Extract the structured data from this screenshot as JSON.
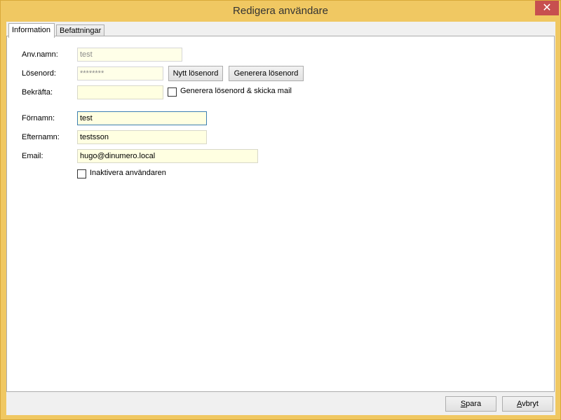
{
  "window": {
    "title": "Redigera användare",
    "close_glyph": "✕"
  },
  "tabs": [
    {
      "label": "Information",
      "active": true
    },
    {
      "label": "Befattningar",
      "active": false
    }
  ],
  "form": {
    "username": {
      "label": "Anv.namn:",
      "value": "test"
    },
    "password": {
      "label": "Lösenord:",
      "value": "********"
    },
    "confirm": {
      "label": "Bekräfta:",
      "value": ""
    },
    "new_password_button": "Nytt lösenord",
    "generate_password_button": "Generera lösenord",
    "generate_and_mail": {
      "label": "Generera lösenord & skicka mail",
      "checked": false
    },
    "firstname": {
      "label": "Förnamn:",
      "value": "test"
    },
    "lastname": {
      "label": "Efternamn:",
      "value": "testsson"
    },
    "email": {
      "label": "Email:",
      "value": "hugo@dinumero.local"
    },
    "deactivate": {
      "label": "Inaktivera användaren",
      "checked": false
    }
  },
  "footer": {
    "save_first": "S",
    "save_rest": "para",
    "cancel_first": "A",
    "cancel_rest": "vbryt"
  },
  "colors": {
    "frame": "#f0c862",
    "field_bg": "#ffffe1",
    "close": "#c74f4f"
  }
}
